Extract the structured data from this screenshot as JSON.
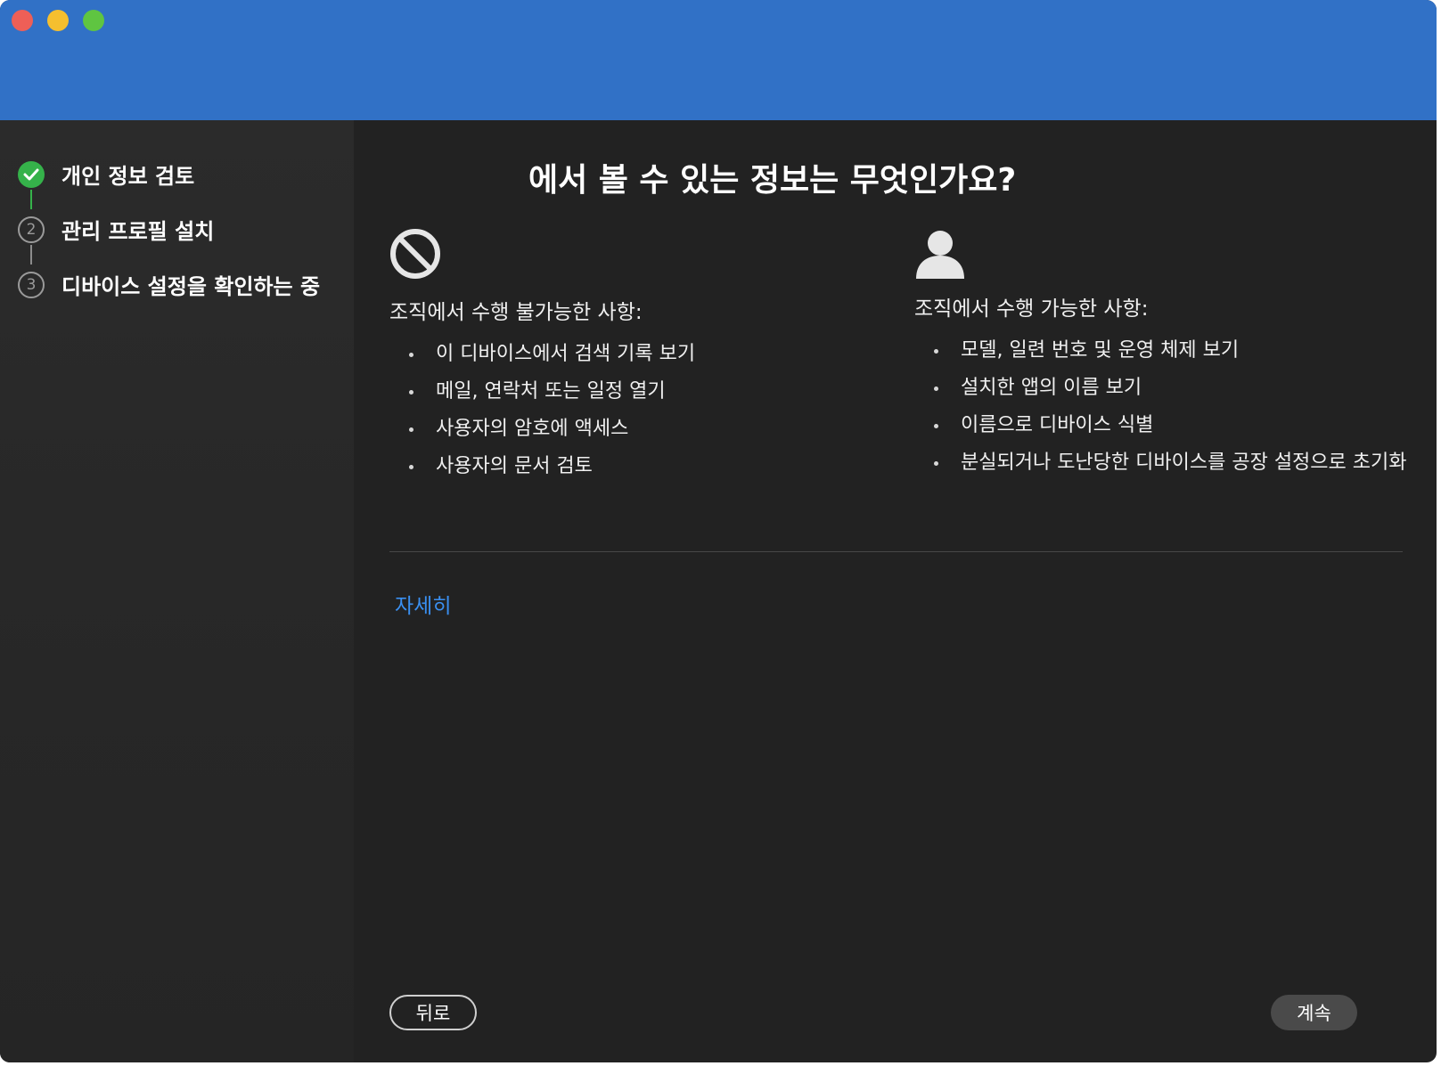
{
  "window": {
    "controls": [
      "close",
      "minimize",
      "maximize"
    ]
  },
  "sidebar": {
    "steps": [
      {
        "number": "",
        "label": "개인 정보 검토",
        "status": "done"
      },
      {
        "number": "2",
        "label": "관리 프로필 설치",
        "status": "pending"
      },
      {
        "number": "3",
        "label": "디바이스 설정을 확인하는 중",
        "status": "pending"
      }
    ]
  },
  "main": {
    "heading": "에서 볼 수 있는 정보는 무엇인가요?",
    "cannot": {
      "icon": "prohibited-icon",
      "title": "조직에서 수행 불가능한 사항:",
      "items": [
        "이 디바이스에서 검색 기록 보기",
        "메일, 연락처 또는 일정 열기",
        "사용자의 암호에 액세스",
        "사용자의 문서 검토"
      ]
    },
    "can": {
      "icon": "person-icon",
      "title": "조직에서 수행 가능한 사항:",
      "items": [
        "모델, 일련 번호 및 운영 체제 보기",
        "설치한 앱의 이름 보기",
        "이름으로 디바이스 식별",
        "분실되거나 도난당한 디바이스를 공장 설정으로 초기화"
      ]
    },
    "more_link": "자세히",
    "back_button": "뒤로",
    "continue_button": "계속"
  },
  "colors": {
    "titlebar": "#3171c6",
    "background": "#222222",
    "sidebar": "#2a2a2a",
    "step_done": "#35b24a",
    "link": "#3a8ff0"
  }
}
